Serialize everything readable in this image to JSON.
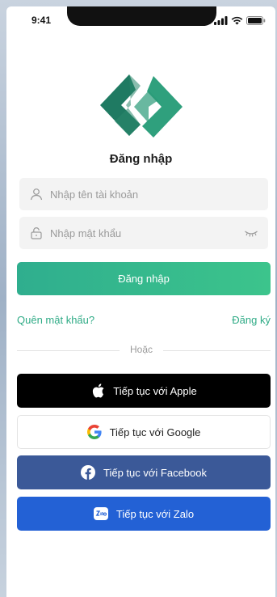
{
  "status_bar": {
    "time": "9:41"
  },
  "login": {
    "title": "Đăng nhập",
    "username_placeholder": "Nhập tên tài khoản",
    "password_placeholder": "Nhập mật khẩu",
    "submit_label": "Đăng nhập",
    "forgot_password": "Quên mật khẩu?",
    "register": "Đăng ký",
    "or_label": "Hoặc"
  },
  "social": {
    "apple": "Tiếp tục với Apple",
    "google": "Tiếp tục với Google",
    "facebook": "Tiếp tục với Facebook",
    "zalo": "Tiếp tục với Zalo"
  },
  "colors": {
    "primary": "#2fae8e",
    "apple": "#000000",
    "facebook": "#3b5998",
    "zalo": "#2361d5",
    "link": "#2fab86"
  },
  "icons": [
    "apple-logo-icon",
    "google-logo-icon",
    "facebook-logo-icon",
    "zalo-logo-icon",
    "user-icon",
    "lock-icon",
    "eye-closed-icon"
  ]
}
